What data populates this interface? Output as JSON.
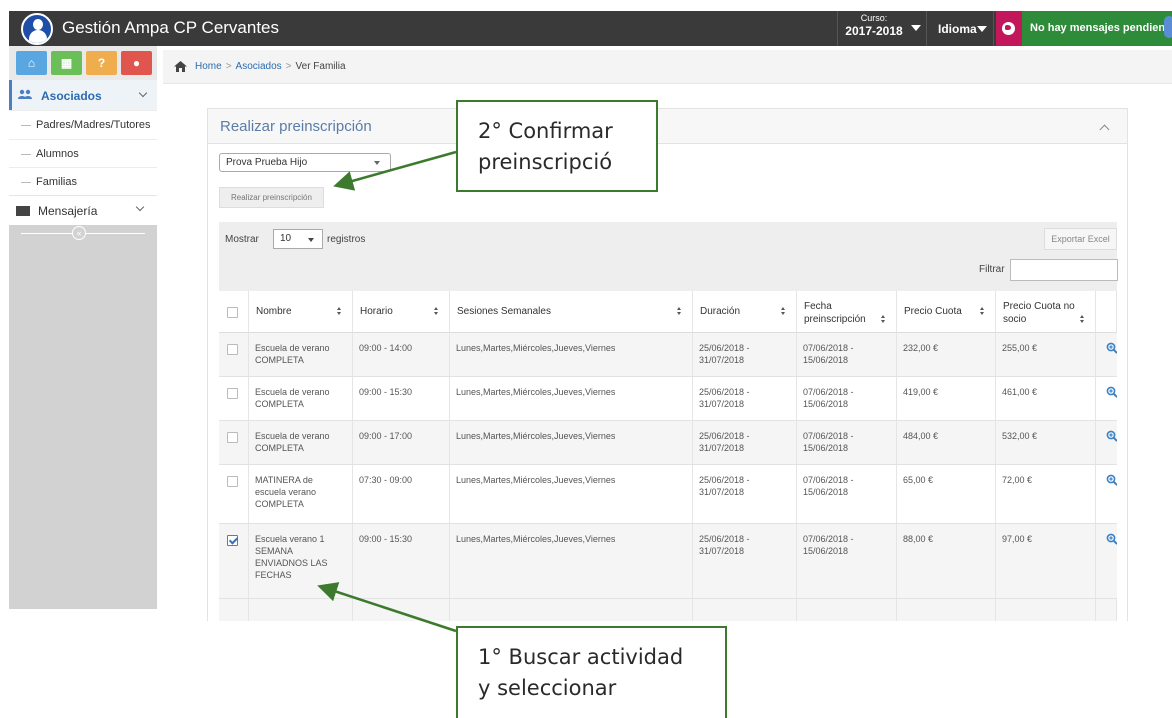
{
  "app": {
    "title": "Gestión Ampa CP Cervantes",
    "curso_label": "Curso:",
    "curso_value": "2017-2018",
    "idioma_label": "Idioma",
    "messages_label": "No hay mensajes pendientes"
  },
  "colors": {
    "topbar": "#3a3a3a",
    "accent_blue": "#2b6cb0",
    "messages_green": "#2e8b3a",
    "globe_magenta": "#c2185b",
    "annotation_green": "#3d7a2e"
  },
  "sidebar": {
    "shortcuts": [
      {
        "icon": "home-icon",
        "glyph": "⌂"
      },
      {
        "icon": "calendar-icon",
        "glyph": "▦"
      },
      {
        "icon": "help-icon",
        "glyph": "?"
      },
      {
        "icon": "chat-icon",
        "glyph": "●"
      }
    ],
    "section": {
      "label": "Asociados",
      "icon": "users-icon"
    },
    "items": [
      {
        "label": "Padres/Madres/Tutores"
      },
      {
        "label": "Alumnos"
      },
      {
        "label": "Familias"
      }
    ],
    "mensajeria": {
      "label": "Mensajería",
      "icon": "envelope-icon"
    },
    "collapse_glyph": "«"
  },
  "breadcrumb": {
    "home": "Home",
    "level1": "Asociados",
    "current": "Ver Familia",
    "separator": ">"
  },
  "panel": {
    "title": "Realizar preinscripción",
    "child_select_value": "Prova Prueba Hijo",
    "submit_button": "Realizar preinscripción"
  },
  "table_controls": {
    "show_prefix": "Mostrar",
    "page_length": "10",
    "show_suffix": "registros",
    "export_button": "Exportar Excel",
    "filter_label": "Filtrar",
    "filter_value": ""
  },
  "table": {
    "columns": [
      "",
      "Nombre",
      "Horario",
      "Sesiones Semanales",
      "Duración",
      "Fecha preinscripción",
      "Precio Cuota",
      "Precio Cuota no socio",
      ""
    ],
    "rows": [
      {
        "checked": false,
        "nombre": "Escuela de verano COMPLETA",
        "horario": "09:00 - 14:00",
        "sesiones": "Lunes,Martes,Miércoles,Jueves,Viernes",
        "duracion": "25/06/2018 - 31/07/2018",
        "fecha": "07/06/2018 - 15/06/2018",
        "precio": "232,00 €",
        "precio_no_socio": "255,00 €"
      },
      {
        "checked": false,
        "nombre": "Escuela de verano COMPLETA",
        "horario": "09:00 - 15:30",
        "sesiones": "Lunes,Martes,Miércoles,Jueves,Viernes",
        "duracion": "25/06/2018 - 31/07/2018",
        "fecha": "07/06/2018 - 15/06/2018",
        "precio": "419,00 €",
        "precio_no_socio": "461,00 €"
      },
      {
        "checked": false,
        "nombre": "Escuela de verano COMPLETA",
        "horario": "09:00 - 17:00",
        "sesiones": "Lunes,Martes,Miércoles,Jueves,Viernes",
        "duracion": "25/06/2018 - 31/07/2018",
        "fecha": "07/06/2018 - 15/06/2018",
        "precio": "484,00 €",
        "precio_no_socio": "532,00 €"
      },
      {
        "checked": false,
        "nombre": "MATINERA de escuela verano COMPLETA",
        "horario": "07:30 - 09:00",
        "sesiones": "Lunes,Martes,Miércoles,Jueves,Viernes",
        "duracion": "25/06/2018 - 31/07/2018",
        "fecha": "07/06/2018 - 15/06/2018",
        "precio": "65,00 €",
        "precio_no_socio": "72,00 €"
      },
      {
        "checked": true,
        "nombre": "Escuela verano 1 SEMANA ENVIADNOS LAS FECHAS",
        "horario": "09:00 - 15:30",
        "sesiones": "Lunes,Martes,Miércoles,Jueves,Viernes",
        "duracion": "25/06/2018 - 31/07/2018",
        "fecha": "07/06/2018 - 15/06/2018",
        "precio": "88,00 €",
        "precio_no_socio": "97,00 €"
      }
    ]
  },
  "annotations": {
    "step2": "2° Confirmar preinscripció",
    "step1": "1° Buscar actividad y seleccionar"
  }
}
